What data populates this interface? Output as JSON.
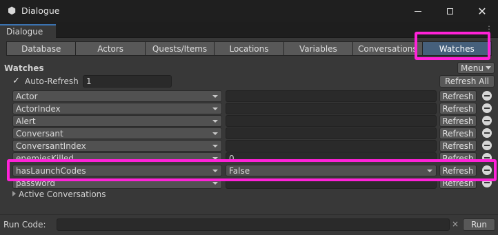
{
  "window": {
    "title": "Dialogue",
    "icon": "unity-cube-icon",
    "controls": [
      "minimize-icon",
      "maximize-icon",
      "close-icon"
    ]
  },
  "dock_tab": {
    "label": "Dialogue"
  },
  "tabs": [
    {
      "label": "Database"
    },
    {
      "label": "Actors"
    },
    {
      "label": "Quests/Items"
    },
    {
      "label": "Locations"
    },
    {
      "label": "Variables"
    },
    {
      "label": "Conversations"
    },
    {
      "label": "Watches",
      "active": true
    }
  ],
  "watches": {
    "heading": "Watches",
    "menu_label": "Menu",
    "auto_refresh_label": "Auto-Refresh",
    "auto_refresh_checked": true,
    "auto_refresh_value": "1",
    "refresh_all_label": "Refresh All",
    "rows": [
      {
        "variable": "Actor",
        "value": "",
        "refresh_label": "Refresh"
      },
      {
        "variable": "ActorIndex",
        "value": "",
        "refresh_label": "Refresh"
      },
      {
        "variable": "Alert",
        "value": "",
        "refresh_label": "Refresh"
      },
      {
        "variable": "Conversant",
        "value": "",
        "refresh_label": "Refresh"
      },
      {
        "variable": "ConversantIndex",
        "value": "",
        "refresh_label": "Refresh"
      },
      {
        "variable": "enemiesKilled",
        "value": "0",
        "refresh_label": "Refresh"
      },
      {
        "variable": "hasLaunchCodes",
        "value": "False",
        "refresh_label": "Refresh",
        "highlighted": true
      },
      {
        "variable": "password",
        "value": "",
        "refresh_label": "Refresh"
      }
    ],
    "active_conversations_label": "Active Conversations"
  },
  "run_code": {
    "label": "Run Code:",
    "value": "",
    "clear_glyph": "×",
    "run_label": "Run"
  },
  "colors": {
    "highlight": "#ff22d8",
    "active_tab": "#46607c",
    "background": "#383838"
  }
}
